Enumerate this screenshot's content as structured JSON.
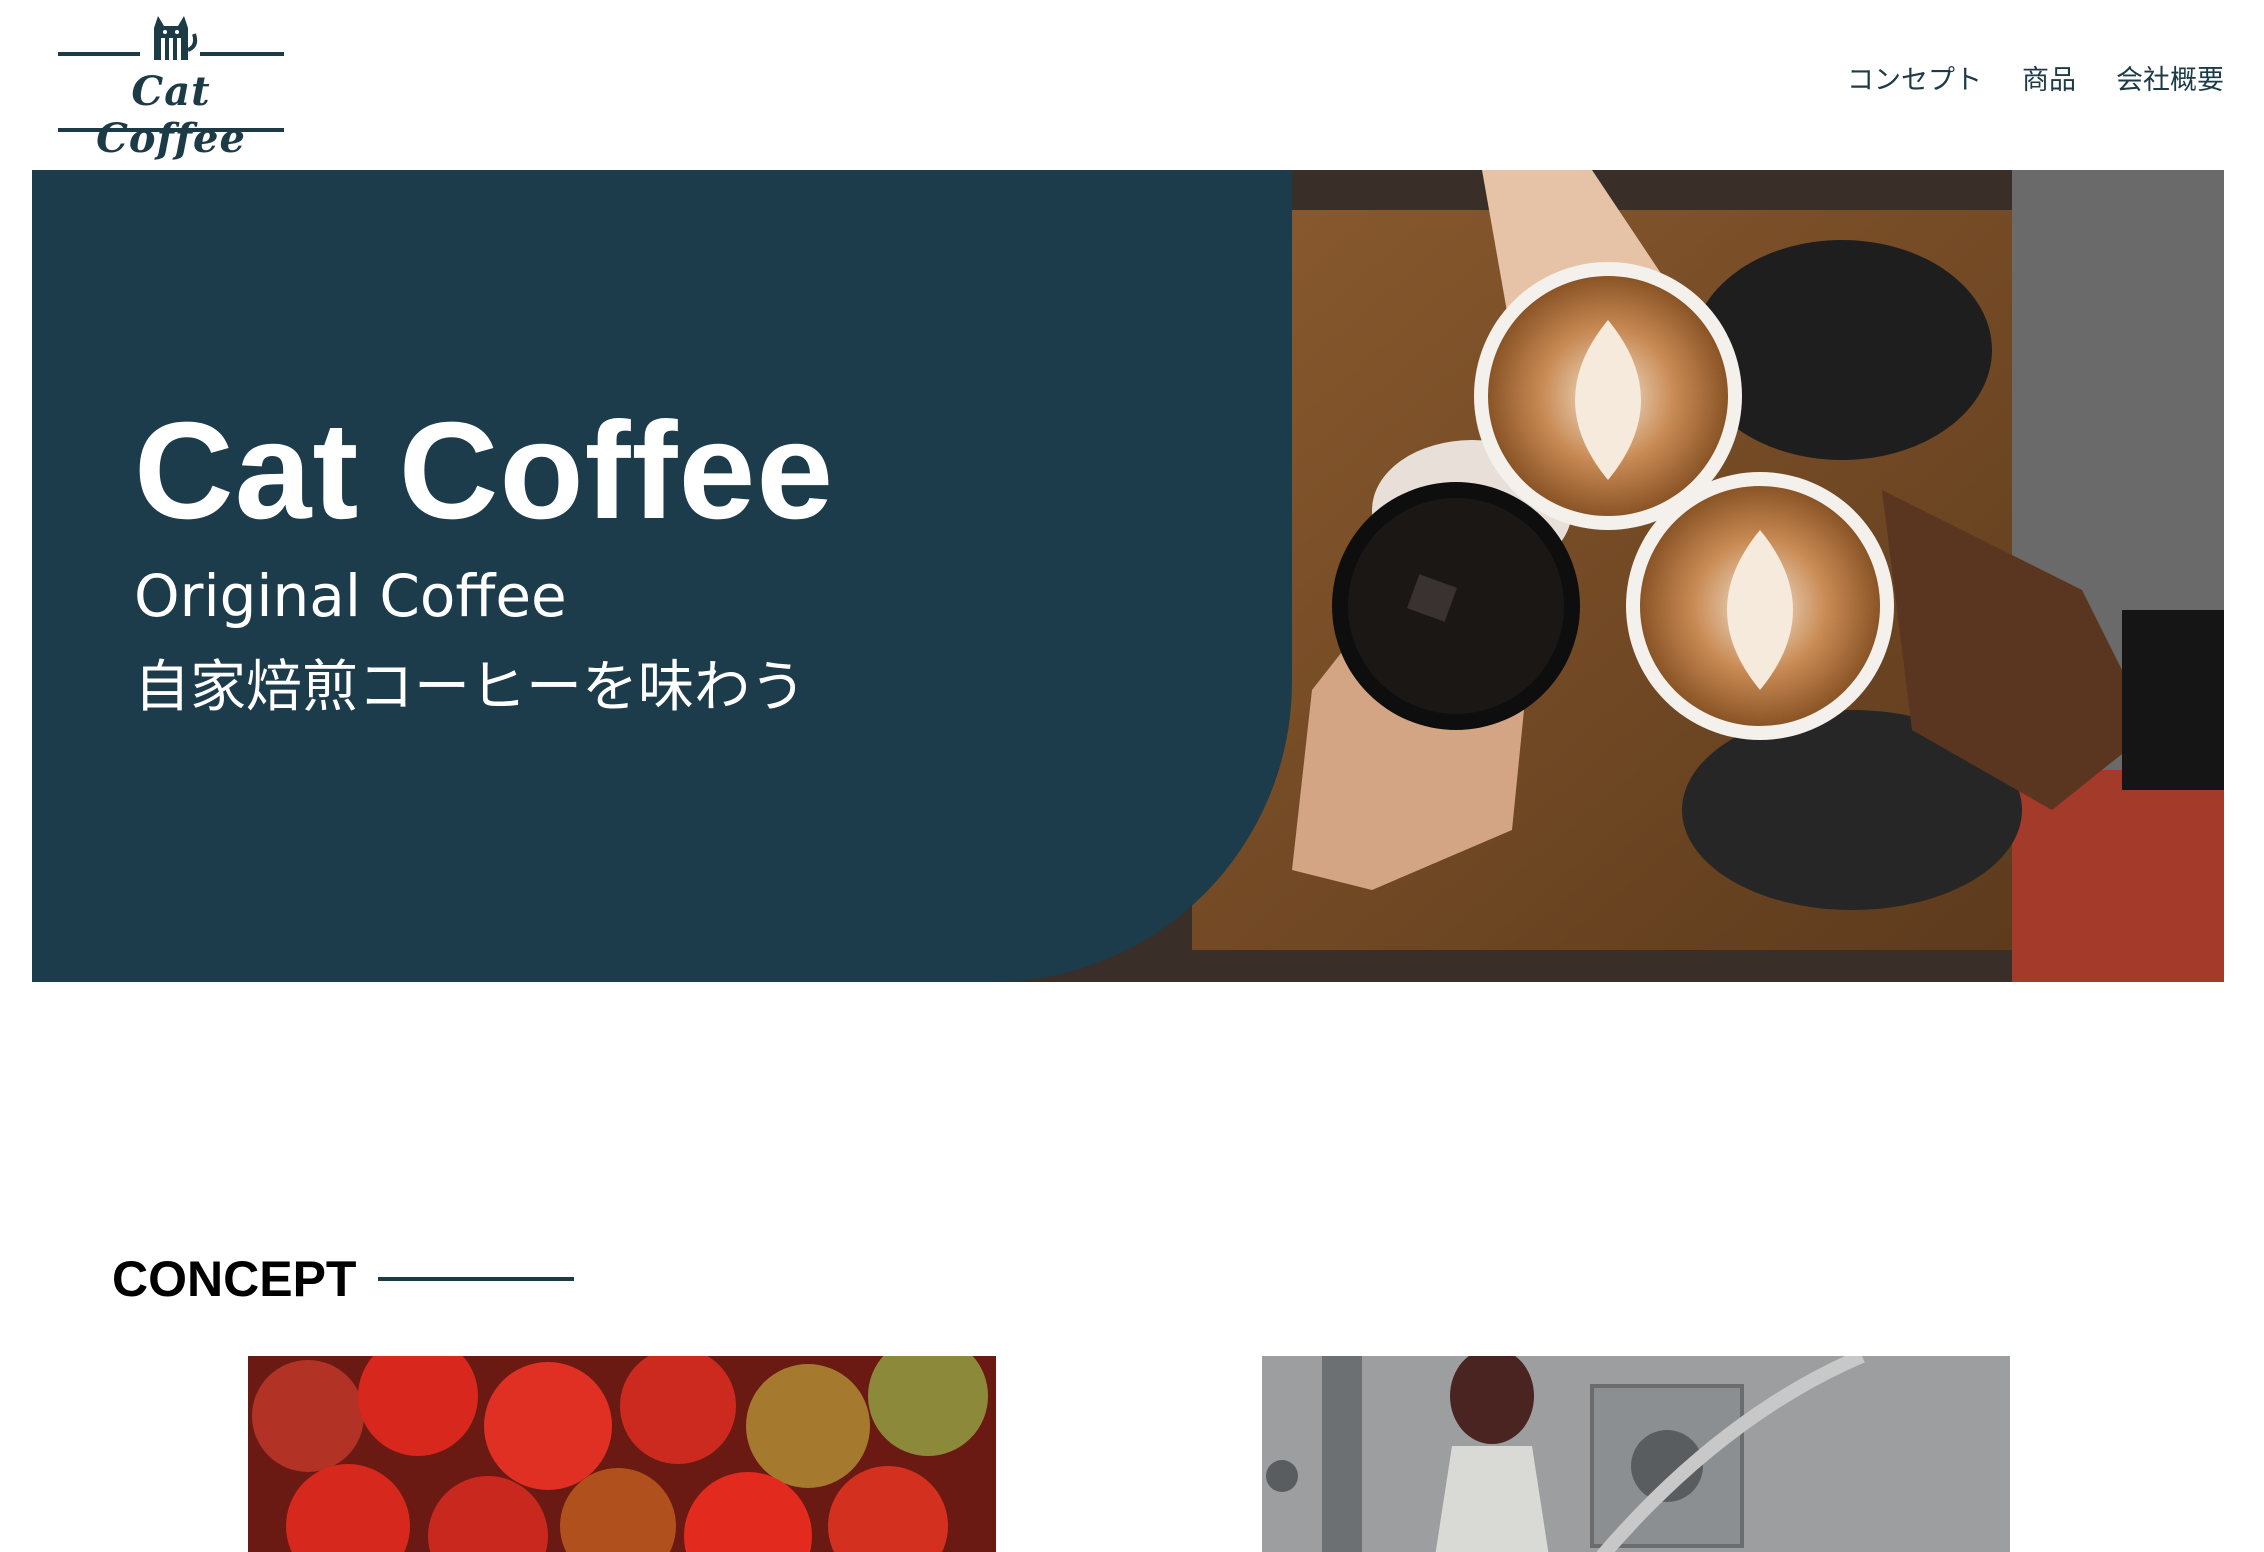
{
  "header": {
    "logo_text": "Cat Coffee",
    "logo_icon": "cat-icon",
    "nav": [
      {
        "label": "コンセプト"
      },
      {
        "label": "商品"
      },
      {
        "label": "会社概要"
      }
    ]
  },
  "hero": {
    "title": "Cat Coffee",
    "subtitle_en": "Original Coffee",
    "subtitle_ja": "自家焙煎コーヒーを味わう",
    "panel_color": "#1c3b4b"
  },
  "concept": {
    "heading": "CONCEPT"
  },
  "colors": {
    "brand": "#1c3b47",
    "text_dark": "#000000",
    "background": "#ffffff"
  }
}
